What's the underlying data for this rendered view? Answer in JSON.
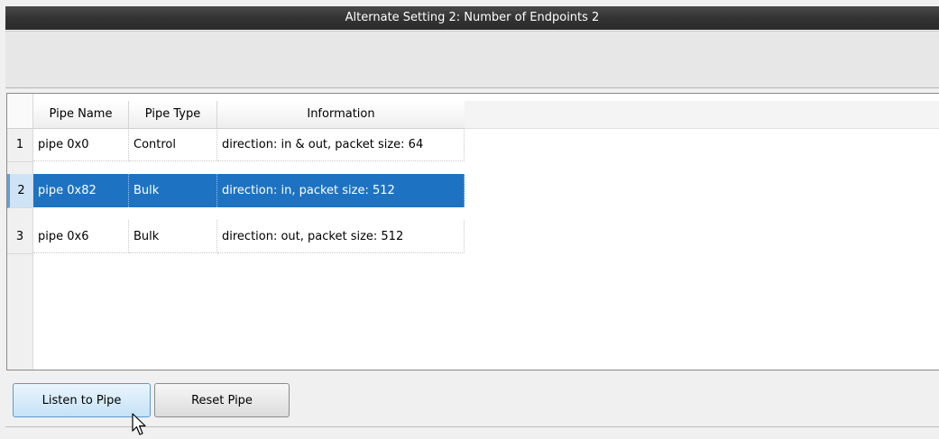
{
  "title": "Alternate Setting 2: Number of Endpoints 2",
  "table": {
    "headers": [
      "Pipe Name",
      "Pipe Type",
      "Information"
    ],
    "rows": [
      {
        "num": "1",
        "name": "pipe 0x0",
        "type": "Control",
        "info": "direction: in & out, packet size: 64"
      },
      {
        "num": "2",
        "name": "pipe 0x82",
        "type": "Bulk",
        "info": "direction: in, packet size: 512"
      },
      {
        "num": "3",
        "name": "pipe 0x6",
        "type": "Bulk",
        "info": "direction: out, packet size: 512"
      }
    ],
    "selected_row": 2
  },
  "buttons": {
    "listen": "Listen to Pipe",
    "reset": "Reset Pipe"
  },
  "colors": {
    "selection": "#1d73c2",
    "title_bar": "#333333"
  }
}
